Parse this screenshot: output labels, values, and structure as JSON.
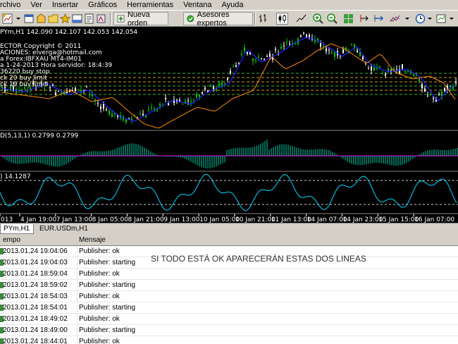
{
  "menu": [
    "rchivo",
    "Ver",
    "Insertar",
    "Gráficos",
    "Herramientas",
    "Ventana",
    "Ayuda"
  ],
  "toolbar": {
    "new_order": "Nueva orden",
    "expert_advisors": "Asesores expertos"
  },
  "chart": {
    "symbol_line": "PYm,H1  142.090 142.107 142.053 142.054",
    "info_lines": [
      "ECTOR  Copyright © 2011",
      "ACIONES: elverga@hotmail.com",
      "a Forex:IBFXAU MT4-IM01",
      "a 1-24-2013 Hora servidor: 18:4:39",
      "36220 buy stop",
      "ck 20 buy limit",
      "ck 19 buy limit"
    ],
    "osc1_label": "D(5,13,1) 0.2799 0.2799",
    "osc2_label": ") 14.1287",
    "time_labels": [
      "013",
      "4 Jan 19:00",
      "7 Jan 13:00",
      "8 Jan 05:00",
      "8 Jan 21:00",
      "9 Jan 13:00",
      "10 Jan 05:00",
      "10 Jan 21:00",
      "11 Jan 13:00",
      "14 Jan 07:00",
      "14 Jan 23:00",
      "15 Jan 15:00",
      "16 Jan 07:00"
    ],
    "colors": {
      "bull": "#00c800",
      "bear": "#ffffff",
      "ma_fast": "#2020ff",
      "ma_slow": "#ff8c00",
      "sar": "#ffd24a",
      "macd": "#00ccaa",
      "stoch": "#00d8ff",
      "signal": "#ff00ff"
    }
  },
  "tabs": [
    "PYm,H1",
    "EUR.USDm,H1"
  ],
  "log": {
    "headers": {
      "time": "empo",
      "message": "Mensaje"
    },
    "annotation": "SI TODO ESTÁ OK APARECERÁN ESTAS DOS LINEAS",
    "rows": [
      {
        "time": "2013.01.24 19:04:06",
        "message": "Publisher: ok"
      },
      {
        "time": "2013.01.24 19:04:03",
        "message": "Publisher: starting"
      },
      {
        "time": "2013.01.24 18:59:04",
        "message": "Publisher: ok"
      },
      {
        "time": "2013.01.24 18:59:02",
        "message": "Publisher: starting"
      },
      {
        "time": "2013.01.24 18:54:03",
        "message": "Publisher: ok"
      },
      {
        "time": "2013.01.24 18:54:01",
        "message": "Publisher: starting"
      },
      {
        "time": "2013.01.24 18:49:02",
        "message": "Publisher: ok"
      },
      {
        "time": "2013.01.24 18:49:00",
        "message": "Publisher: starting"
      },
      {
        "time": "2013.01.24 18:44:01",
        "message": "Publisher: ok"
      }
    ]
  }
}
